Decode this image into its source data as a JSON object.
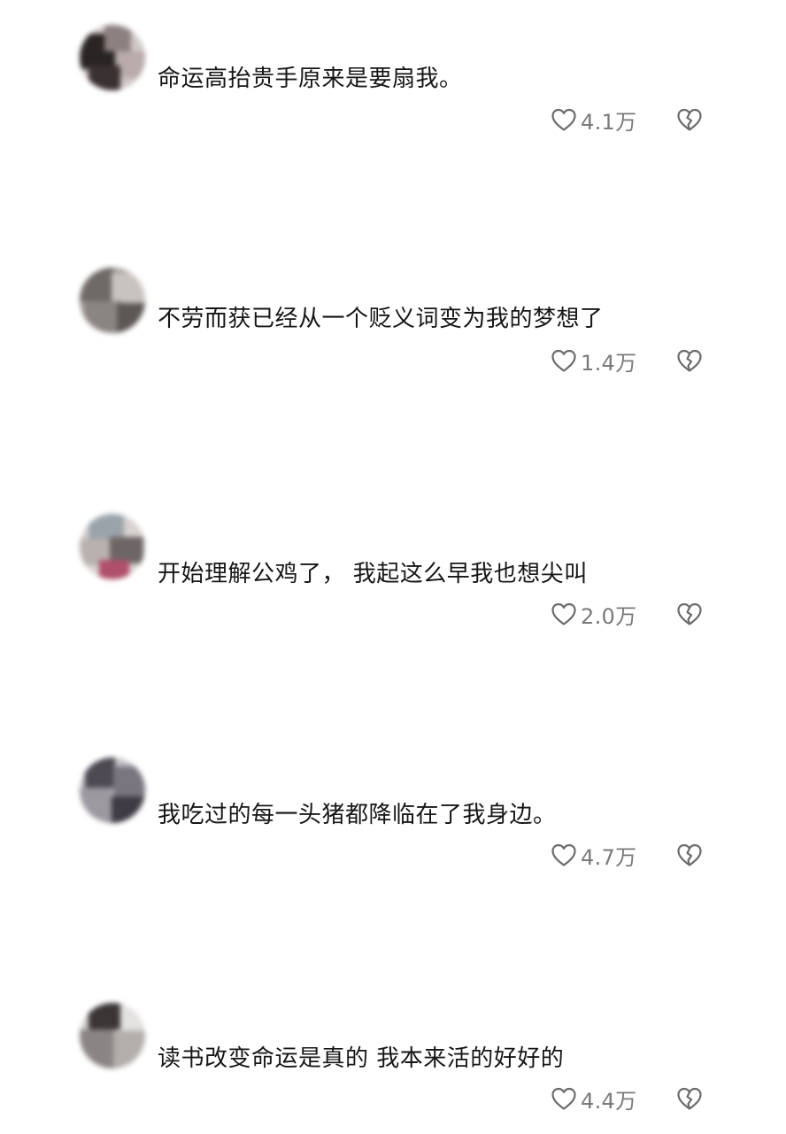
{
  "comments": [
    {
      "text": "命运高抬贵手原来是要扇我。",
      "likes": "4.1万",
      "avatar_icon": "blurred-avatar"
    },
    {
      "text": "不劳而获已经从一个贬义词变为我的梦想了",
      "likes": "1.4万",
      "avatar_icon": "blurred-avatar"
    },
    {
      "text": "开始理解公鸡了， 我起这么早我也想尖叫",
      "likes": "2.0万",
      "avatar_icon": "blurred-avatar"
    },
    {
      "text": "我吃过的每一头猪都降临在了我身边。",
      "likes": "4.7万",
      "avatar_icon": "blurred-avatar"
    },
    {
      "text": "读书改变命运是真的 我本来活的好好的",
      "likes": "4.4万",
      "avatar_icon": "blurred-avatar"
    }
  ],
  "icons": {
    "like": "heart-outline-icon",
    "dislike": "broken-heart-icon"
  },
  "colors": {
    "background": "#ffffff",
    "text": "#161616",
    "meta": "#7a7a7a"
  }
}
